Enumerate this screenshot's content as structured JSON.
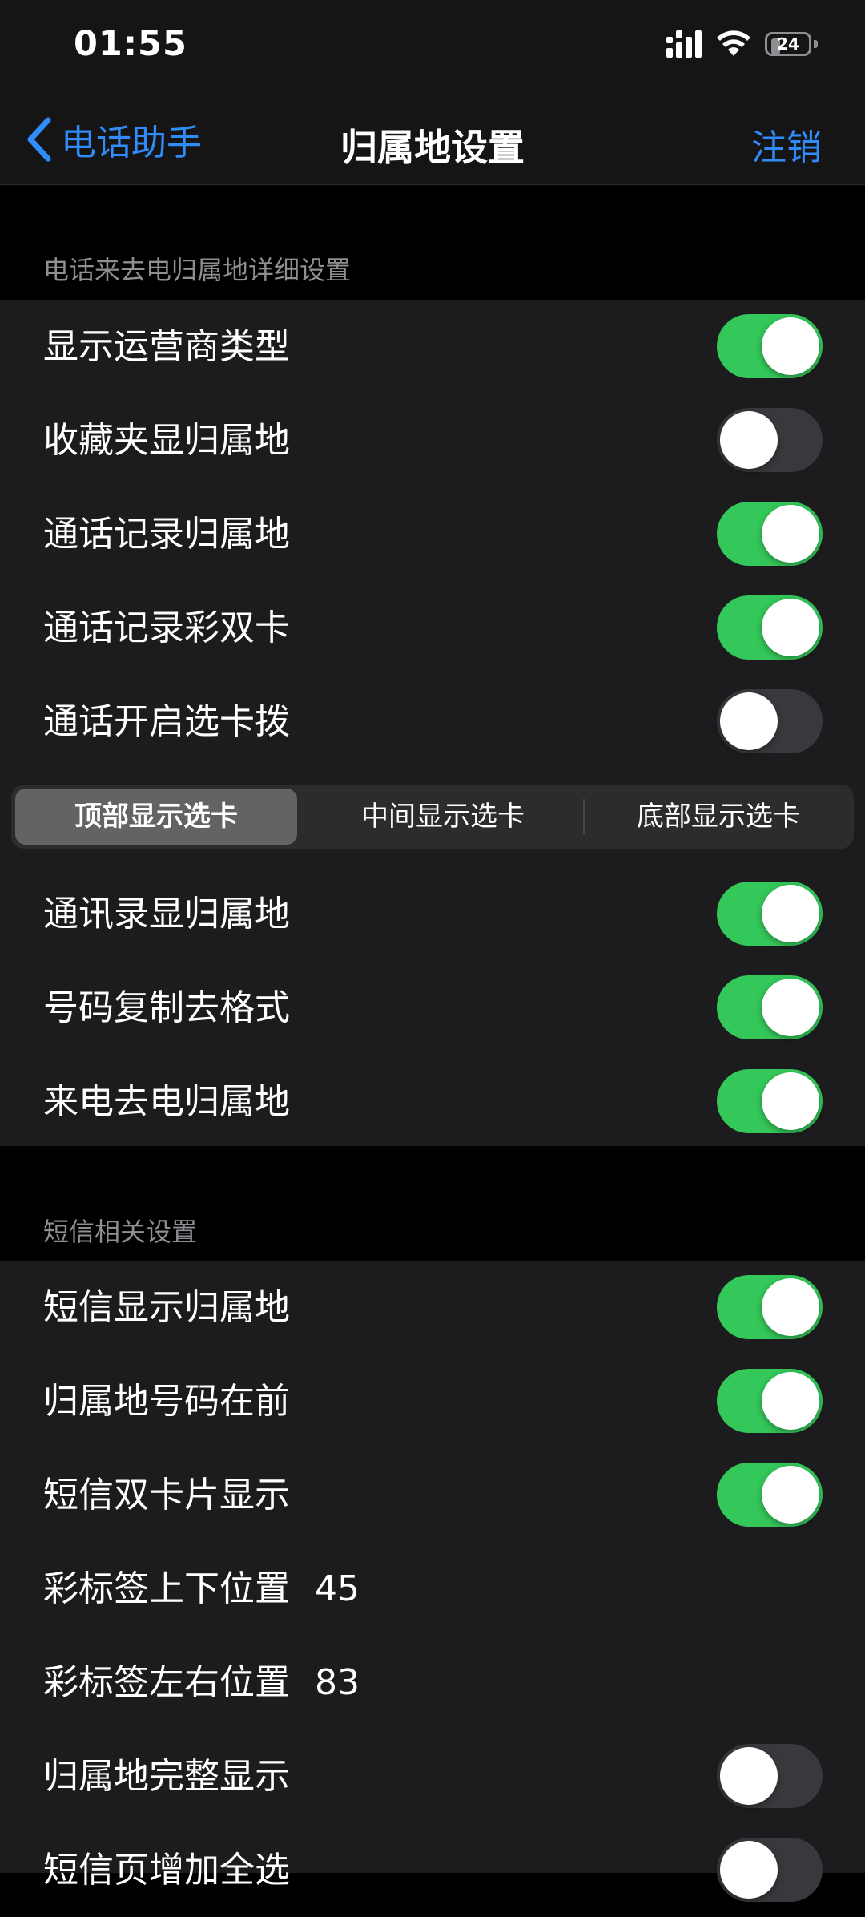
{
  "status_bar": {
    "time": "01:55",
    "battery": "24"
  },
  "nav": {
    "back_label": "电话助手",
    "title": "归属地设置",
    "right_label": "注销"
  },
  "sections": [
    {
      "header": "电话来去电归属地详细设置",
      "rows_top": [
        {
          "label": "显示运营商类型",
          "on": true
        },
        {
          "label": "收藏夹显归属地",
          "on": false
        },
        {
          "label": "通话记录归属地",
          "on": true
        },
        {
          "label": "通话记录彩双卡",
          "on": true
        },
        {
          "label": "通话开启选卡拨",
          "on": false
        }
      ],
      "segments": [
        "顶部显示选卡",
        "中间显示选卡",
        "底部显示选卡"
      ],
      "segment_selected": "顶部显示选卡",
      "rows_bottom": [
        {
          "label": "通讯录显归属地",
          "on": true
        },
        {
          "label": "号码复制去格式",
          "on": true
        },
        {
          "label": "来电去电归属地",
          "on": true
        }
      ]
    },
    {
      "header": "短信相关设置",
      "rows": [
        {
          "label": "短信显示归属地",
          "on": true
        },
        {
          "label": "归属地号码在前",
          "on": true
        },
        {
          "label": "短信双卡片显示",
          "on": true
        },
        {
          "label": "彩标签上下位置",
          "value": "45"
        },
        {
          "label": "彩标签左右位置",
          "value": "83"
        },
        {
          "label": "归属地完整显示",
          "on": false
        },
        {
          "label": "短信页增加全选",
          "on": false
        }
      ]
    }
  ],
  "colors": {
    "accent": "#2f8cfa",
    "toggle_on": "#34c759",
    "toggle_off": "#39393d",
    "group_bg": "#1c1c1e",
    "page_bg": "#000000"
  },
  "icons": [
    "signal-icon",
    "wifi-icon",
    "battery-icon",
    "back-chevron-icon"
  ]
}
